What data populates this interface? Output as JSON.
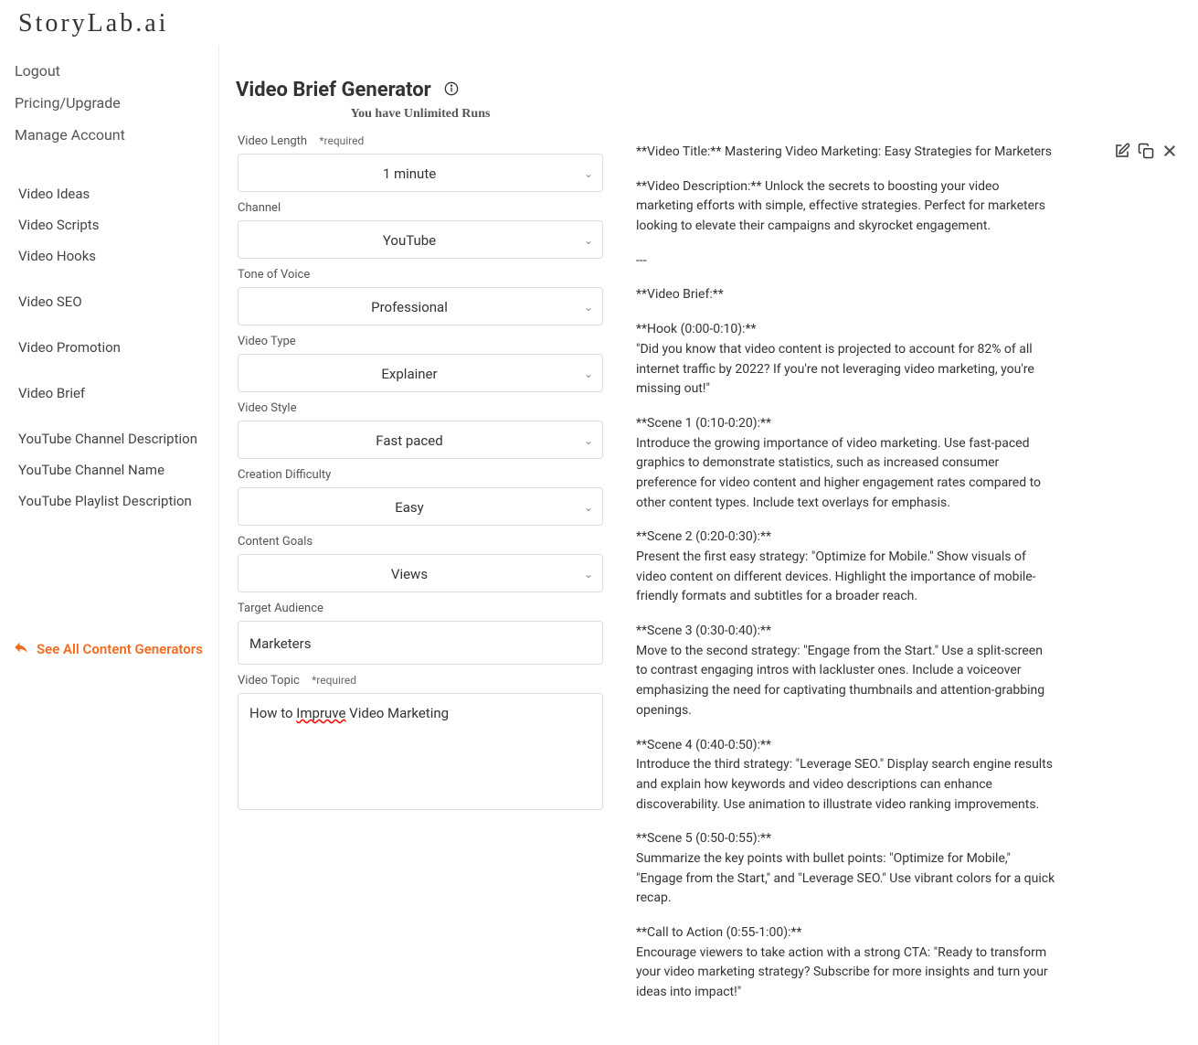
{
  "logo": "StoryLab.ai",
  "account_nav": {
    "logout": "Logout",
    "pricing": "Pricing/Upgrade",
    "manage": "Manage Account"
  },
  "sidebar": {
    "items": [
      {
        "label": "Video Ideas"
      },
      {
        "label": "Video Scripts"
      },
      {
        "label": "Video Hooks"
      },
      {
        "label": "Video SEO"
      },
      {
        "label": "Video Promotion"
      },
      {
        "label": "Video Brief"
      },
      {
        "label": "YouTube Channel Description"
      },
      {
        "label": "YouTube Channel Name"
      },
      {
        "label": "YouTube Playlist Description"
      }
    ],
    "see_all": "See All Content Generators"
  },
  "header": {
    "title": "Video Brief Generator",
    "runs": "You have Unlimited Runs"
  },
  "form": {
    "required_marker": "*required",
    "video_length": {
      "label": "Video Length",
      "value": "1 minute"
    },
    "channel": {
      "label": "Channel",
      "value": "YouTube"
    },
    "tone": {
      "label": "Tone of Voice",
      "value": "Professional"
    },
    "video_type": {
      "label": "Video Type",
      "value": "Explainer"
    },
    "video_style": {
      "label": "Video Style",
      "value": "Fast paced"
    },
    "difficulty": {
      "label": "Creation Difficulty",
      "value": "Easy"
    },
    "goals": {
      "label": "Content Goals",
      "value": "Views"
    },
    "audience": {
      "label": "Target Audience",
      "value": "Marketers"
    },
    "topic": {
      "label": "Video Topic",
      "prefix": "How to ",
      "misspell": "Impruve",
      "suffix": " Video Marketing"
    }
  },
  "output": {
    "title_label": "**Video Title:** ",
    "title_text": "Mastering Video Marketing: Easy Strategies for Marketers",
    "desc_label": "**Video Description:** ",
    "desc_text": "Unlock the secrets to boosting your video marketing efforts with simple, effective strategies. Perfect for marketers looking to elevate their campaigns and skyrocket engagement.",
    "divider": "---",
    "brief_label": "**Video Brief:**",
    "hook_label": "**Hook (0:00-0:10):**",
    "hook_text": "\"Did you know that video content is projected to account for 82% of all internet traffic by 2022? If you're not leveraging video marketing, you're missing out!\"",
    "s1_label": "**Scene 1 (0:10-0:20):**",
    "s1_text": "Introduce the growing importance of video marketing. Use fast-paced graphics to demonstrate statistics, such as increased consumer preference for video content and higher engagement rates compared to other content types. Include text overlays for emphasis.",
    "s2_label": "**Scene 2 (0:20-0:30):**",
    "s2_text": "Present the first easy strategy: \"Optimize for Mobile.\" Show visuals of video content on different devices. Highlight the importance of mobile-friendly formats and subtitles for a broader reach.",
    "s3_label": "**Scene 3 (0:30-0:40):**",
    "s3_text": "Move to the second strategy: \"Engage from the Start.\" Use a split-screen to contrast engaging intros with lackluster ones. Include a voiceover emphasizing the need for captivating thumbnails and attention-grabbing openings.",
    "s4_label": "**Scene 4 (0:40-0:50):**",
    "s4_text": "Introduce the third strategy: \"Leverage SEO.\" Display search engine results and explain how keywords and video descriptions can enhance discoverability. Use animation to illustrate video ranking improvements.",
    "s5_label": "**Scene 5 (0:50-0:55):**",
    "s5_text": "Summarize the key points with bullet points: \"Optimize for Mobile,\" \"Engage from the Start,\" and \"Leverage SEO.\" Use vibrant colors for a quick recap.",
    "cta_label": "**Call to Action (0:55-1:00):**",
    "cta_text": "Encourage viewers to take action with a strong CTA: \"Ready to transform your video marketing strategy? Subscribe for more insights and turn your ideas into impact!\""
  }
}
